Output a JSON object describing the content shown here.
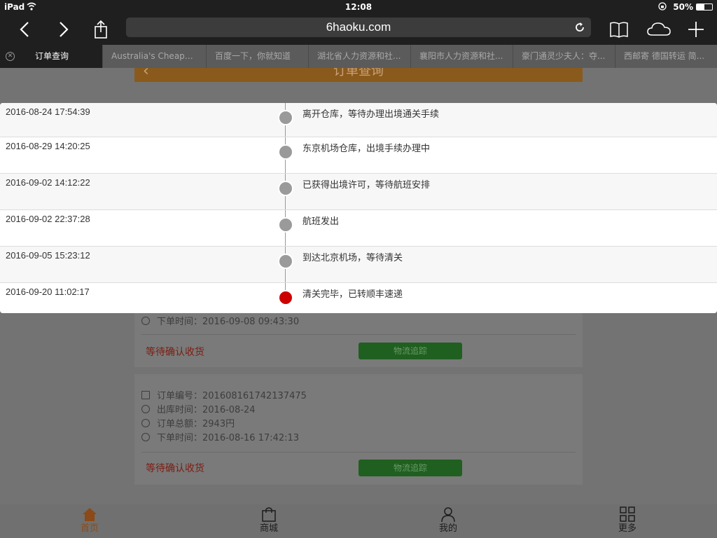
{
  "status_bar": {
    "device": "iPad",
    "time": "12:08",
    "battery": "50%"
  },
  "browser": {
    "url": "6haoku.com",
    "tabs": [
      {
        "label": "订单查询",
        "active": true
      },
      {
        "label": "Australia's Cheape...",
        "active": false
      },
      {
        "label": "百度一下，你就知道",
        "active": false
      },
      {
        "label": "湖北省人力资源和社...",
        "active": false
      },
      {
        "label": "襄阳市人力资源和社...",
        "active": false
      },
      {
        "label": "豪门通灵少夫人：夺...",
        "active": false
      },
      {
        "label": "西邮寄 德国转运 简...",
        "active": false
      }
    ]
  },
  "page": {
    "header_title": "订单查询",
    "order1": {
      "order_time_label": "下单时间：",
      "order_time": "2016-09-08 09:43:30",
      "status": "等待确认收货",
      "track_button": "物流追踪"
    },
    "order2": {
      "order_no_label": "订单编号：",
      "order_no": "201608161742137475",
      "ship_time_label": "出库时间：",
      "ship_time": "2016-08-24",
      "total_label": "订单总额：",
      "total": "2943円",
      "order_time_label": "下单时间：",
      "order_time": "2016-08-16 17:42:13",
      "status": "等待确认收货",
      "track_button": "物流追踪"
    }
  },
  "bottom_nav": [
    {
      "label": "首页",
      "icon": "home-icon",
      "active": true
    },
    {
      "label": "商城",
      "icon": "shopping-bag-icon",
      "active": false
    },
    {
      "label": "我的",
      "icon": "user-icon",
      "active": false
    },
    {
      "label": "更多",
      "icon": "grid-icon",
      "active": false
    }
  ],
  "tracking": [
    {
      "time": "2016-08-24 17:54:39",
      "desc": "离开仓库，等待办理出境通关手续",
      "current": false
    },
    {
      "time": "2016-08-29 14:20:25",
      "desc": "东京机场仓库，出境手续办理中",
      "current": false
    },
    {
      "time": "2016-09-02 14:12:22",
      "desc": "已获得出境许可，等待航班安排",
      "current": false
    },
    {
      "time": "2016-09-02 22:37:28",
      "desc": "航班发出",
      "current": false
    },
    {
      "time": "2016-09-05 15:23:12",
      "desc": "到达北京机场，等待清关",
      "current": false
    },
    {
      "time": "2016-09-20 11:02:17",
      "desc": "清关完毕，已转顺丰速递",
      "current": true
    }
  ],
  "colors": {
    "current_dot": "#cc0000",
    "past_dot": "#9a9a9a",
    "accent": "#e8750f",
    "track_button": "#2e8b2e"
  }
}
